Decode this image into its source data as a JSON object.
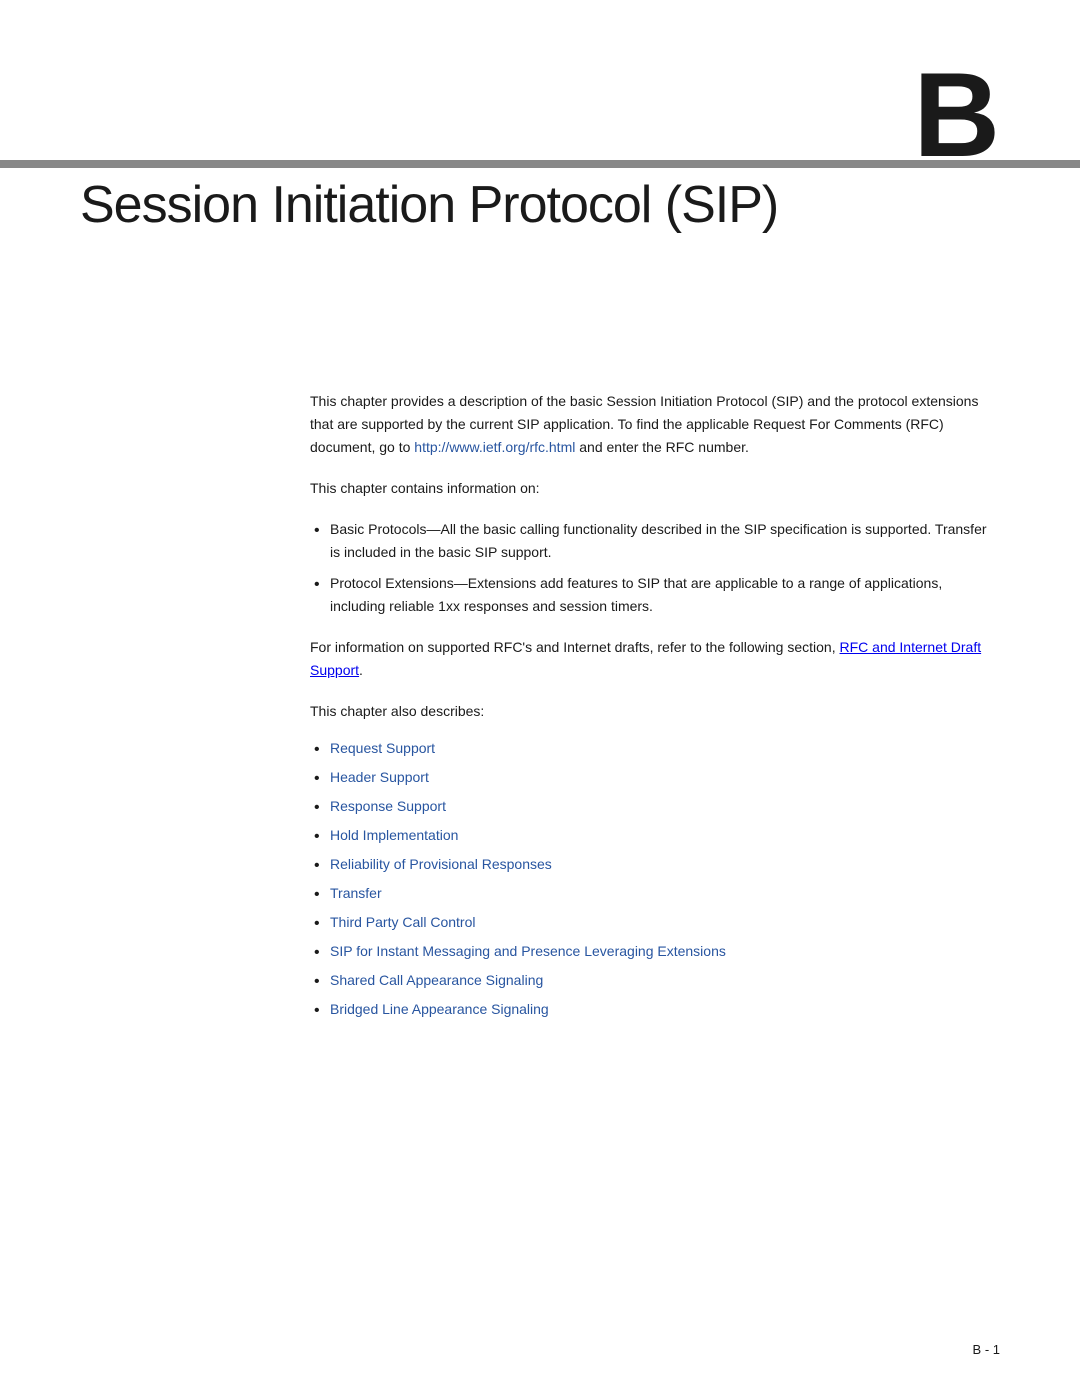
{
  "chapter": {
    "letter": "B",
    "title": "Session Initiation Protocol (SIP)"
  },
  "content": {
    "intro1": "This chapter provides a description of the basic Session Initiation Protocol (SIP) and the protocol extensions that are supported by the current SIP application. To find the applicable Request For Comments (RFC) document, go to ",
    "intro1_link_text": "http://www.ietf.org/rfc.html",
    "intro1_link_href": "http://www.ietf.org/rfc.html",
    "intro1_end": " and enter the RFC number.",
    "contains_info": "This chapter contains information on:",
    "bullets": [
      {
        "text": "Basic Protocols—All the basic calling functionality described in the SIP specification is supported. Transfer is included in the basic SIP support."
      },
      {
        "text": "Protocol Extensions—Extensions add features to SIP that are applicable to a range of applications, including reliable 1xx responses and session timers."
      }
    ],
    "for_info": "For information on supported RFC's and Internet drafts, refer to the following section, ",
    "for_info_link_text": "RFC and Internet Draft Support",
    "for_info_link_href": "#rfc-internet-draft-support",
    "for_info_end": ".",
    "also_describes": "This chapter also describes:",
    "links": [
      {
        "label": "Request Support",
        "href": "#request-support"
      },
      {
        "label": "Header Support",
        "href": "#header-support"
      },
      {
        "label": "Response Support",
        "href": "#response-support"
      },
      {
        "label": "Hold Implementation",
        "href": "#hold-implementation"
      },
      {
        "label": "Reliability of Provisional Responses",
        "href": "#reliability-of-provisional-responses"
      },
      {
        "label": "Transfer",
        "href": "#transfer"
      },
      {
        "label": "Third Party Call Control",
        "href": "#third-party-call-control"
      },
      {
        "label": "SIP for Instant Messaging and Presence Leveraging Extensions",
        "href": "#sip-for-instant-messaging"
      },
      {
        "label": "Shared Call Appearance Signaling",
        "href": "#shared-call-appearance-signaling"
      },
      {
        "label": "Bridged Line Appearance Signaling",
        "href": "#bridged-line-appearance-signaling"
      }
    ]
  },
  "footer": {
    "page_number": "B - 1"
  }
}
